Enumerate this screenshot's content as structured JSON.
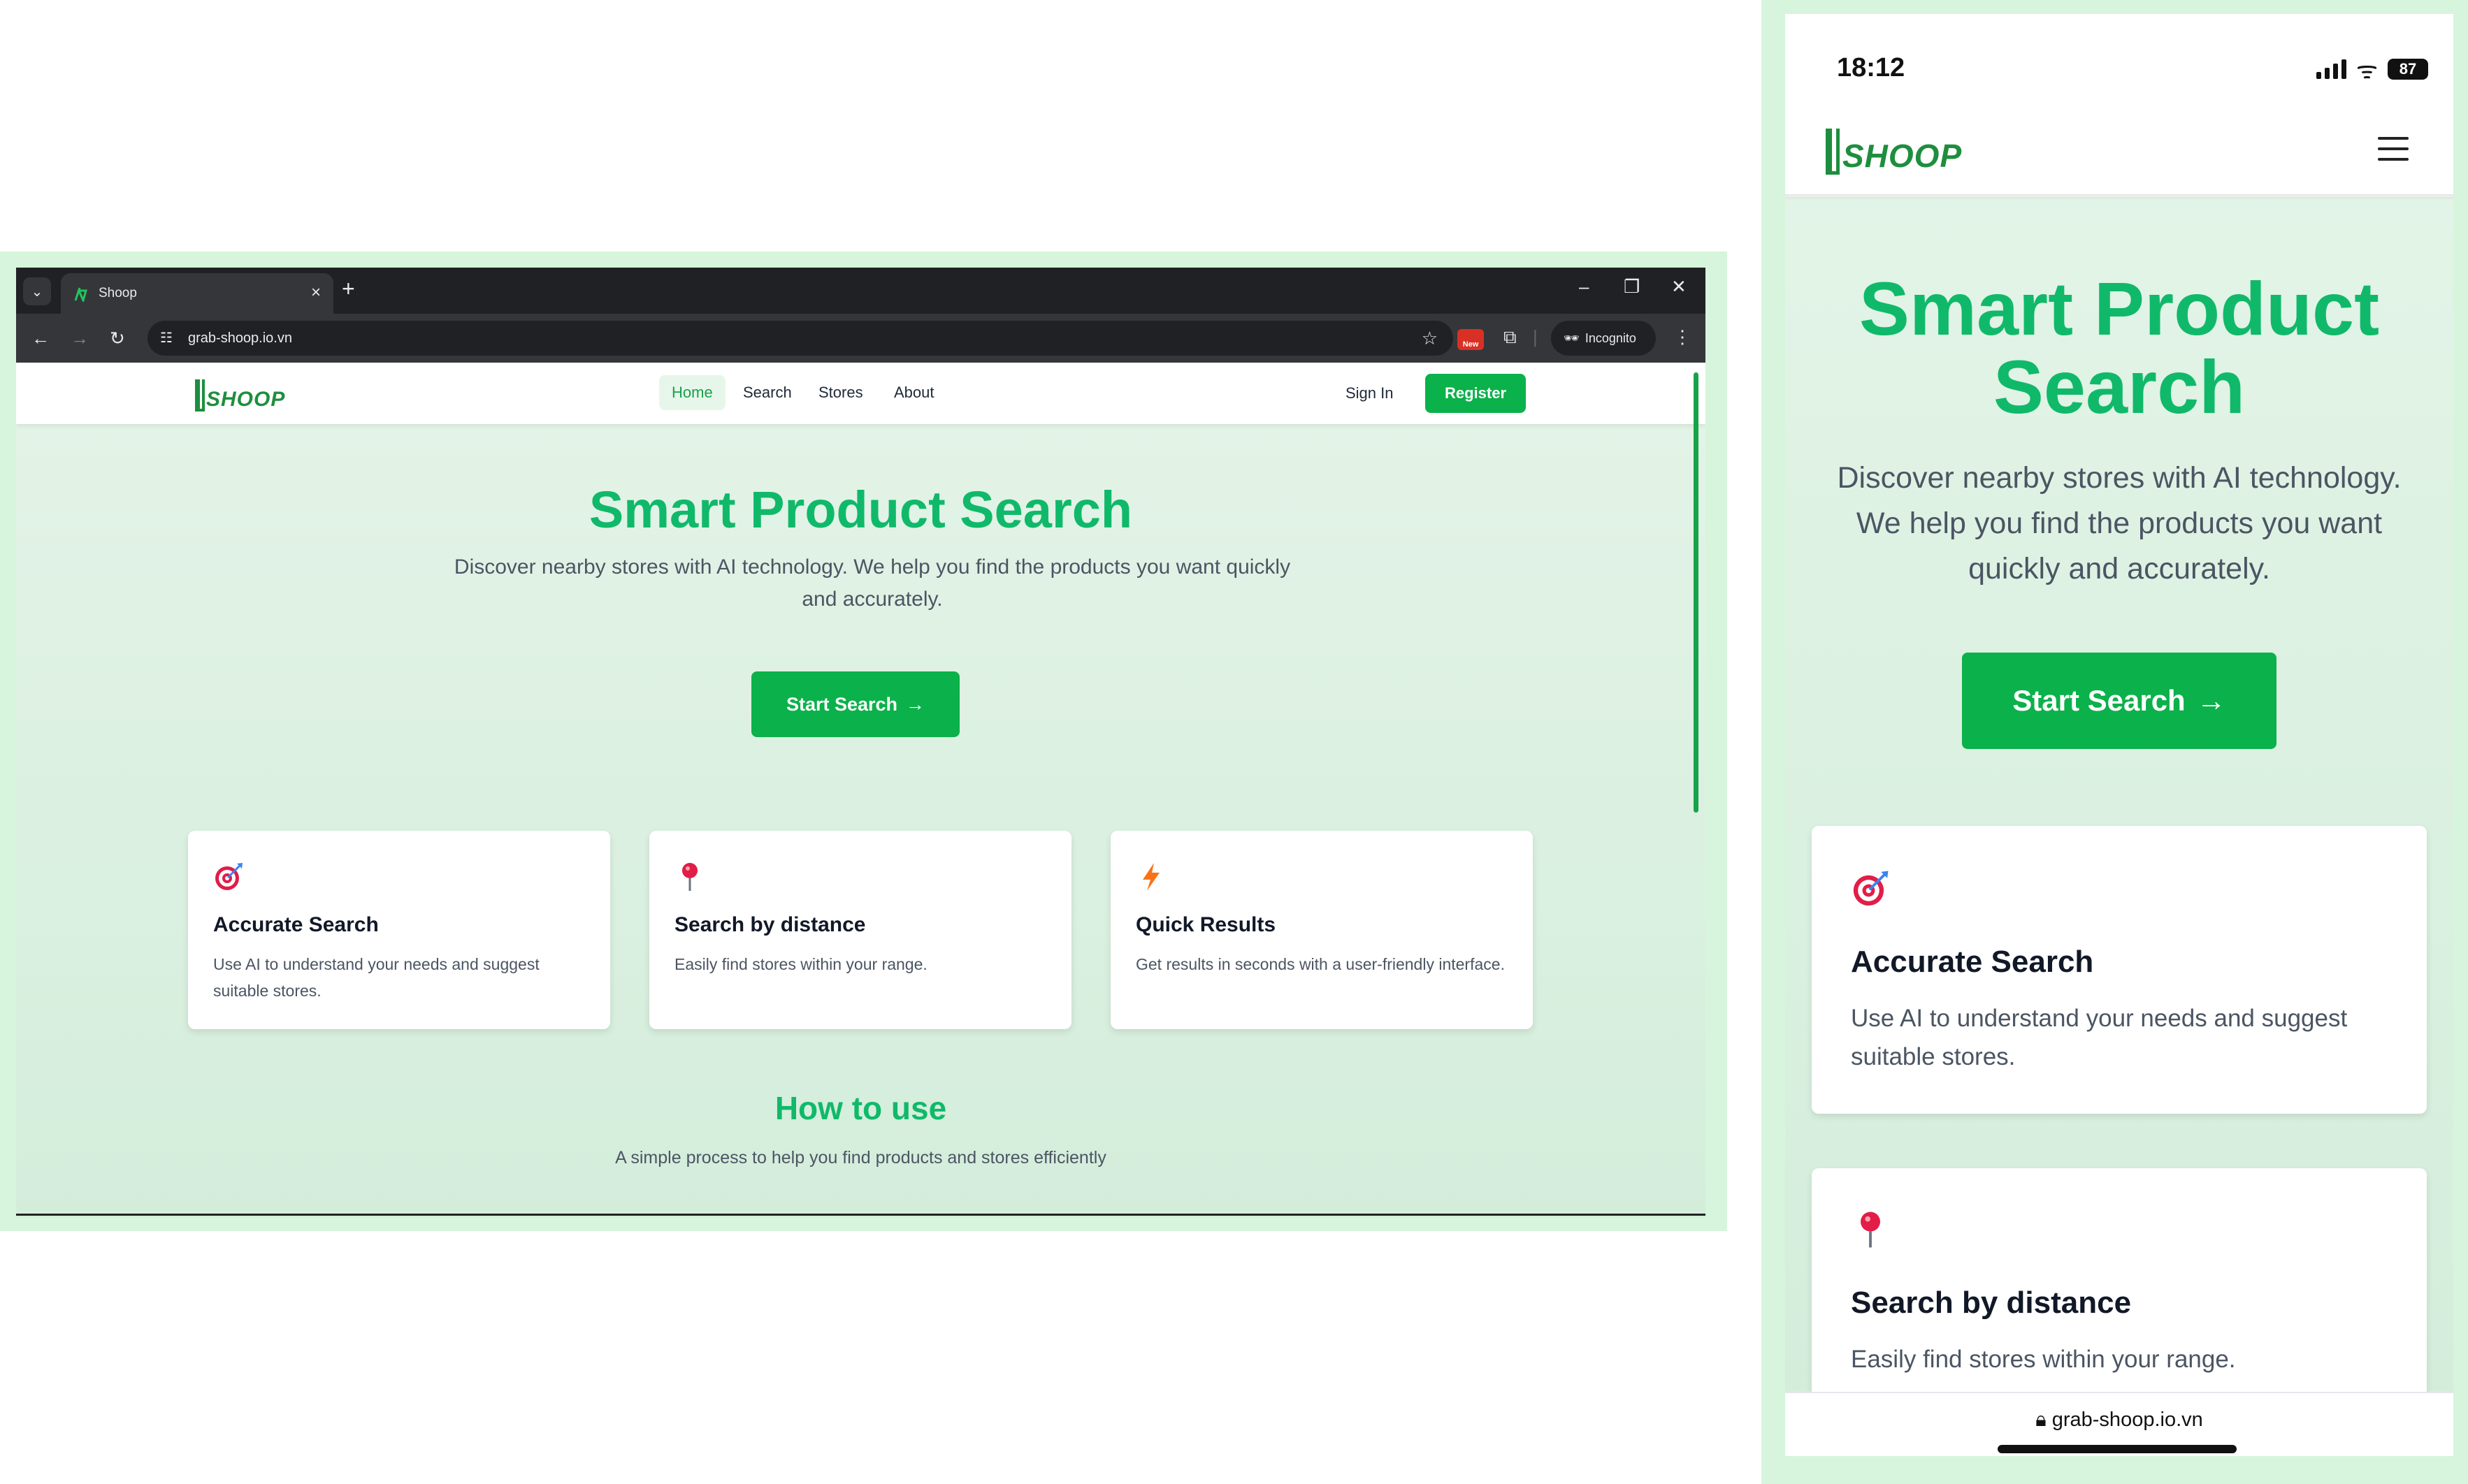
{
  "desktop": {
    "browser": {
      "tab_title": "Shoop",
      "tab_close": "×",
      "new_tab": "+",
      "url": "grab-shoop.io.vn",
      "ext_badge": "New",
      "incognito_label": "Incognito"
    },
    "site": {
      "logo_text": "SHOOP",
      "nav": [
        "Home",
        "Search",
        "Stores",
        "About"
      ],
      "sign_in": "Sign In",
      "register": "Register",
      "hero_title": "Smart Product Search",
      "hero_subtitle": "Discover nearby stores with AI technology. We help you find the products you want quickly and accurately.",
      "cta_label": "Start Search",
      "cta_arrow": "→",
      "features": [
        {
          "title": "Accurate Search",
          "desc": "Use AI to understand your needs and suggest suitable stores.",
          "icon": "target-icon"
        },
        {
          "title": "Search by distance",
          "desc": "Easily find stores within your range.",
          "icon": "pin-icon"
        },
        {
          "title": "Quick Results",
          "desc": "Get results in seconds with a user-friendly interface.",
          "icon": "lightning-icon"
        }
      ],
      "howto_title": "How to use",
      "howto_subtitle": "A simple process to help you find products and stores efficiently"
    }
  },
  "mobile": {
    "status": {
      "time": "18:12",
      "battery": "87"
    },
    "logo_text": "SHOOP",
    "hero_title": "Smart Product Search",
    "hero_subtitle": "Discover nearby stores with AI technology. We help you find the products you want quickly and accurately.",
    "cta_label": "Start Search",
    "cta_arrow": "→",
    "features": [
      {
        "title": "Accurate Search",
        "desc": "Use AI to understand your needs and suggest suitable stores."
      },
      {
        "title": "Search by distance",
        "desc": "Easily find stores within your range."
      }
    ],
    "url": "grab-shoop.io.vn"
  },
  "colors": {
    "brand_green": "#10b96a",
    "button_green": "#0bb14a",
    "frame_bg": "#d6f5dc"
  }
}
